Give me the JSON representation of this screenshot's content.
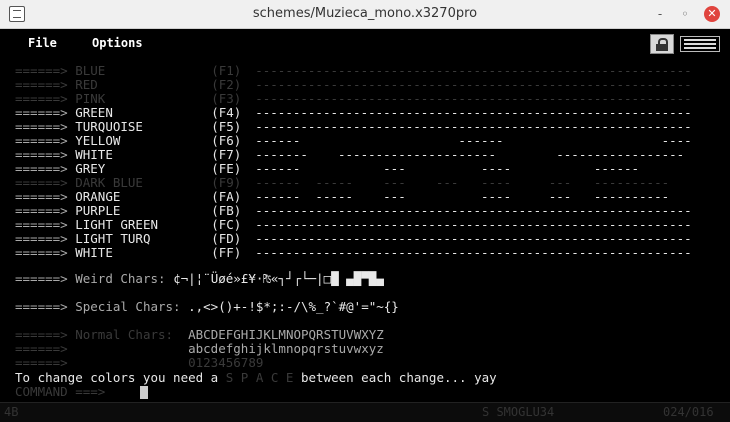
{
  "window": {
    "title": "schemes/Muzieca_mono.x3270pro",
    "min": "-",
    "max": "◦",
    "close": "✕"
  },
  "menu": {
    "file": "File",
    "options": "Options"
  },
  "colors": {
    "bg": "#000000",
    "text": "#e8e8e8",
    "dim": "#3a3a3a",
    "close": "#e0443e"
  },
  "rows": [
    {
      "arrow": "======>",
      "name": "BLUE",
      "key": "(F1)",
      "bars": "----------------------------------------------------------"
    },
    {
      "arrow": "======>",
      "name": "RED",
      "key": "(F2)",
      "bars": "----------------------------------------------------------"
    },
    {
      "arrow": "======>",
      "name": "PINK",
      "key": "(F3)",
      "bars": "----------------------------------------------------------"
    },
    {
      "arrow": "======>",
      "name": "GREEN",
      "key": "(F4)",
      "bars": "----------------------------------------------------------"
    },
    {
      "arrow": "======>",
      "name": "TURQUOISE",
      "key": "(F5)",
      "bars": "----------------------------------------------------------"
    },
    {
      "arrow": "======>",
      "name": "YELLOW",
      "key": "(F6)",
      "bars": "------                     ------                     ----"
    },
    {
      "arrow": "======>",
      "name": "WHITE",
      "key": "(F7)",
      "bars": "-------    ---------------------        -----------------"
    },
    {
      "arrow": "======>",
      "name": "GREY",
      "key": "(FE)",
      "bars": "------           ---          ----           ------      "
    },
    {
      "arrow": "======>",
      "name": "DARK BLUE",
      "key": "(F9)",
      "bars": "------  -----    ---    ---   ----     ---   ----------"
    },
    {
      "arrow": "======>",
      "name": "ORANGE",
      "key": "(FA)",
      "bars": "------  -----    ---          ----     ---   ----------"
    },
    {
      "arrow": "======>",
      "name": "PURPLE",
      "key": "(FB)",
      "bars": "----------------------------------------------------------"
    },
    {
      "arrow": "======>",
      "name": "LIGHT GREEN",
      "key": "(FC)",
      "bars": "----------------------------------------------------------"
    },
    {
      "arrow": "======>",
      "name": "LIGHT TURQ",
      "key": "(FD)",
      "bars": "----------------------------------------------------------"
    },
    {
      "arrow": "======>",
      "name": "WHITE",
      "key": "(FF)",
      "bars": "----------------------------------------------------------"
    }
  ],
  "weird": {
    "arrow": "======>",
    "label": "Weird Chars:",
    "value": "¢¬|¦¨Üøé»£¥·₧«┐┘┌└─|□█ ▄█▀█▄"
  },
  "special": {
    "arrow": "======>",
    "label": "Special Chars:",
    "value": ".,<>()+-!$*;:-/\\%_?`#@'=\"~{}"
  },
  "normal": {
    "arrow": "======>",
    "label": "Normal Chars:",
    "line1": "ABCDEFGHIJKLMNOPQRSTUVWXYZ",
    "line2": "abcdefghijklmnopqrstuvwxyz",
    "line3": "0123456789"
  },
  "message": {
    "pre": "To change colors you need a ",
    "word": "S P A C E",
    "post": " between each change... yay"
  },
  "command": {
    "prompt": "COMMAND ===>"
  },
  "status": {
    "left": "4B",
    "mid": "S SMOGLU34",
    "right": "024/016"
  }
}
